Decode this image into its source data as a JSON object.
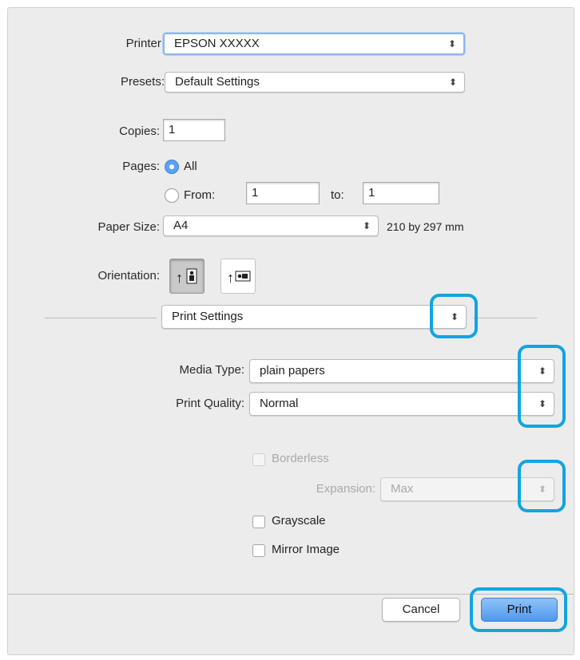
{
  "printer": {
    "label": "Printer:",
    "value": "EPSON XXXXX"
  },
  "presets": {
    "label": "Presets:",
    "value": "Default Settings"
  },
  "copies": {
    "label": "Copies:",
    "value": "1"
  },
  "pages": {
    "label": "Pages:",
    "all_label": "All",
    "from_label": "From:",
    "from_value": "1",
    "to_label": "to:",
    "to_value": "1",
    "selected": "All"
  },
  "paper_size": {
    "label": "Paper Size:",
    "value": "A4",
    "dimensions": "210 by 297 mm"
  },
  "orientation": {
    "label": "Orientation:",
    "selected": "portrait"
  },
  "section": {
    "value": "Print Settings"
  },
  "media_type": {
    "label": "Media Type:",
    "value": "plain papers"
  },
  "print_quality": {
    "label": "Print Quality:",
    "value": "Normal"
  },
  "borderless": {
    "label": "Borderless",
    "checked": false,
    "enabled": false
  },
  "expansion": {
    "label": "Expansion:",
    "value": "Max",
    "enabled": false
  },
  "grayscale": {
    "label": "Grayscale",
    "checked": false
  },
  "mirror_image": {
    "label": "Mirror Image",
    "checked": false
  },
  "buttons": {
    "cancel": "Cancel",
    "print": "Print"
  },
  "popup_arrows": "⬍",
  "highlight_color": "#11a5e0"
}
